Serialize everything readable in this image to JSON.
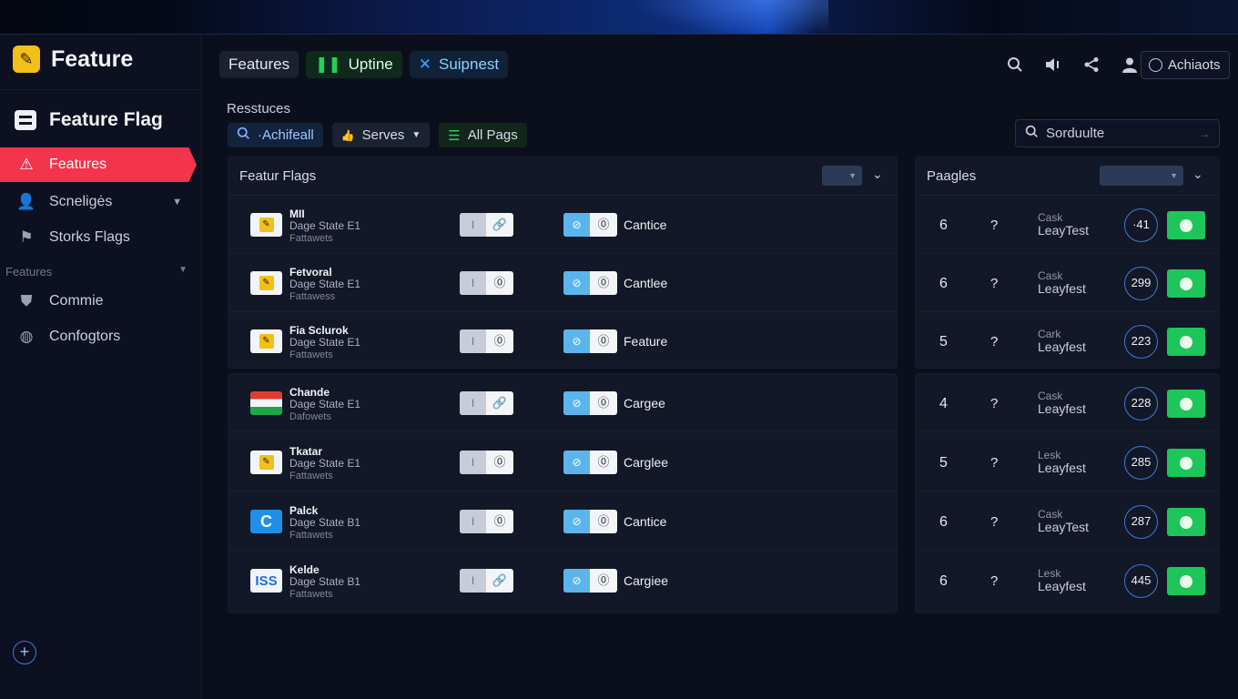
{
  "app": {
    "brand": "Feature",
    "section_title": "Feature Flag"
  },
  "sidebar": {
    "items": [
      {
        "label": "Features",
        "icon": "warning-icon",
        "active": true
      },
      {
        "label": "Scneligės",
        "icon": "users-icon"
      },
      {
        "label": "Storks Flags",
        "icon": "flag-grid-icon"
      }
    ],
    "group_label": "Features",
    "group_items": [
      {
        "label": "Commie",
        "icon": "shield-icon"
      },
      {
        "label": "Confoɡtors",
        "icon": "globe-icon"
      }
    ]
  },
  "header": {
    "tabs": [
      {
        "label": "Features"
      },
      {
        "label": "Uptine"
      },
      {
        "label": "Suipnest"
      }
    ],
    "account_label": "Achiaots"
  },
  "resources": {
    "label": "Resstuces",
    "filters": [
      {
        "label": "·Achifeall"
      },
      {
        "label": "Serves"
      },
      {
        "label": "All Pags"
      }
    ],
    "search_value": "Sorduulte"
  },
  "flags_panel": {
    "title": "Featur Flags",
    "rows": [
      {
        "name": "MII",
        "sub": "Dage State E1",
        "sub2": "Fattawets",
        "icon": "yellow",
        "action": "Cantice"
      },
      {
        "name": "Fetvoral",
        "sub": "Dage State E1",
        "sub2": "Fattawess",
        "icon": "yellow",
        "action": "Cantlee"
      },
      {
        "name": "Fia Sclurok",
        "sub": "Dage State E1",
        "sub2": "Fattawets",
        "icon": "yellow",
        "action": "Feature"
      },
      {
        "name": "Chande",
        "sub": "Dage State E1",
        "sub2": "Dafowets",
        "icon": "tricolor",
        "action": "Cargee"
      },
      {
        "name": "Tkatar",
        "sub": "Dage State E1",
        "sub2": "Fattawets",
        "icon": "yellow",
        "action": "Carglee"
      },
      {
        "name": "Palck",
        "sub": "Dage State B1",
        "sub2": "Fattawets",
        "icon": "c-blue",
        "action": "Cantice"
      },
      {
        "name": "Kelde",
        "sub": "Dage State B1",
        "sub2": "Fattawets",
        "icon": "iss",
        "action": "Cargiee"
      }
    ]
  },
  "pages_panel": {
    "title": "Paagles",
    "rows": [
      {
        "num": "6",
        "q": "?",
        "t1": "Cask",
        "t2": "LeayTest",
        "circle": "·41"
      },
      {
        "num": "6",
        "q": "?",
        "t1": "Cask",
        "t2": "Leayfest",
        "circle": "299"
      },
      {
        "num": "5",
        "q": "?",
        "t1": "Cark",
        "t2": "Leayfest",
        "circle": "223"
      },
      {
        "num": "4",
        "q": "?",
        "t1": "Cask",
        "t2": "Leayfest",
        "circle": "228"
      },
      {
        "num": "5",
        "q": "?",
        "t1": "Lesk",
        "t2": "Leayfest",
        "circle": "285"
      },
      {
        "num": "6",
        "q": "?",
        "t1": "Cask",
        "t2": "LeayTest",
        "circle": "287"
      },
      {
        "num": "6",
        "q": "?",
        "t1": "Lesk",
        "t2": "Leayfest",
        "circle": "445"
      }
    ]
  },
  "colors": {
    "accent_red": "#f2344c",
    "accent_green": "#1ec55a",
    "brand_yellow": "#f2c018",
    "accent_blue": "#3f7ad6"
  }
}
